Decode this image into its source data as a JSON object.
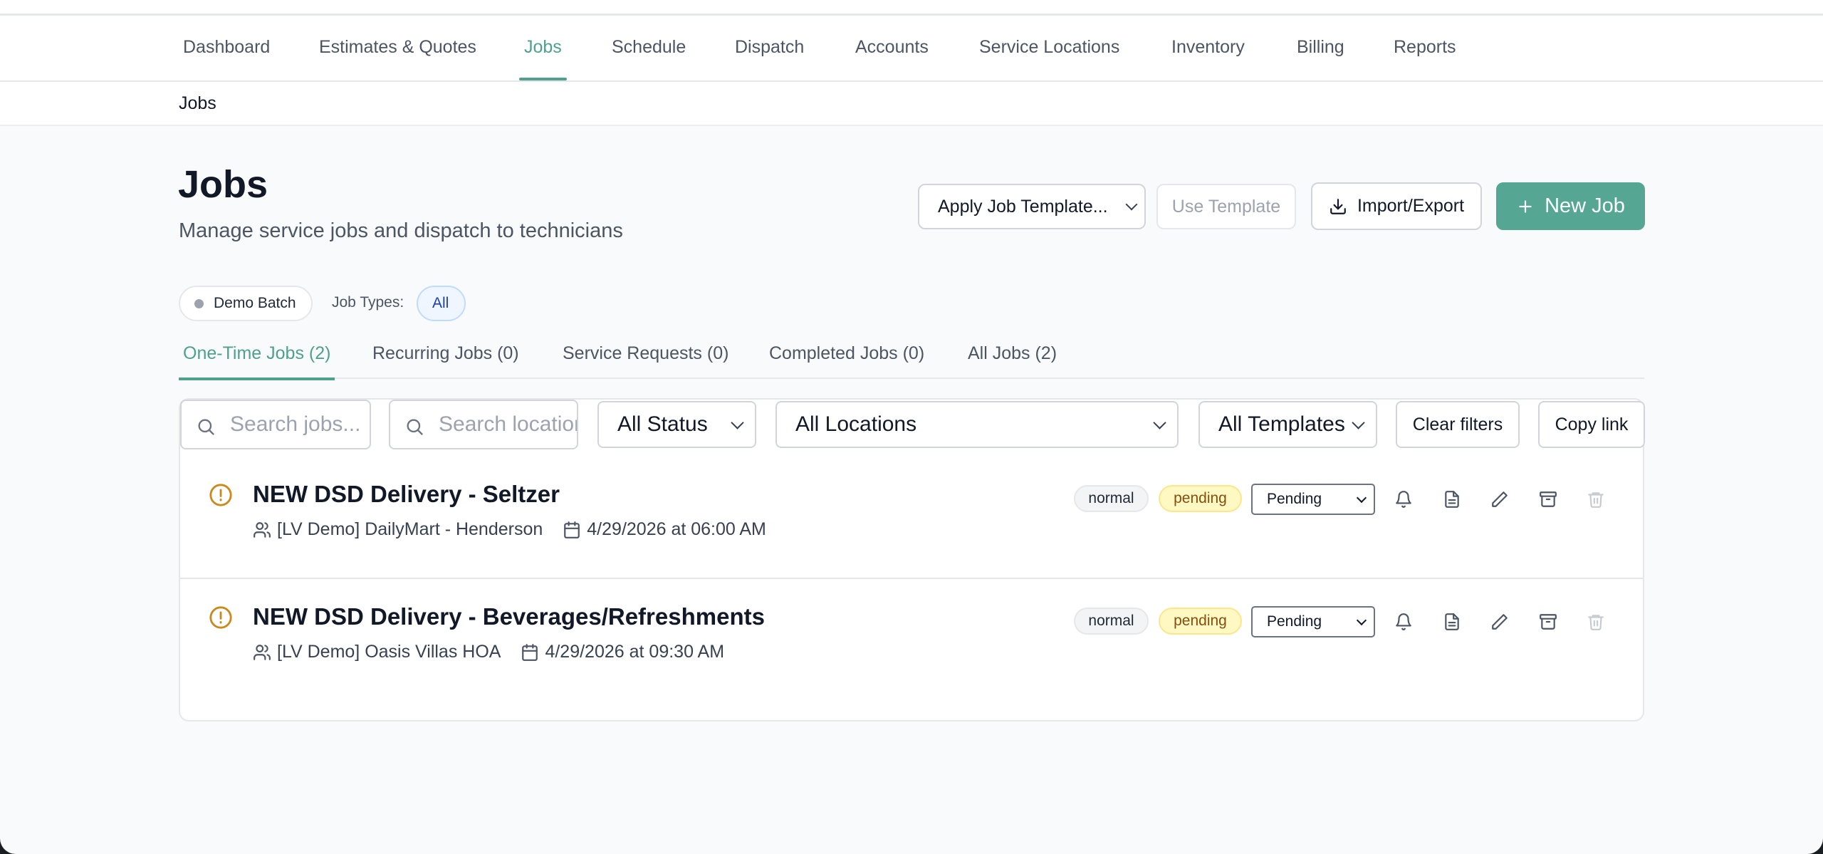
{
  "nav": {
    "items": [
      "Dashboard",
      "Estimates & Quotes",
      "Jobs",
      "Schedule",
      "Dispatch",
      "Accounts",
      "Service Locations",
      "Inventory",
      "Billing",
      "Reports"
    ],
    "active": "Jobs"
  },
  "breadcrumb": "Jobs",
  "page": {
    "title": "Jobs",
    "subtitle": "Manage service jobs and dispatch to technicians"
  },
  "toolbar": {
    "apply_template": "Apply Job Template...",
    "use_template": "Use Template",
    "import_export": "Import/Export",
    "new_job": "New Job"
  },
  "batch": {
    "label": "Demo Batch",
    "job_types_label": "Job Types:",
    "job_types_value": "All"
  },
  "tabs": [
    {
      "label": "One-Time Jobs (2)",
      "active": true
    },
    {
      "label": "Recurring Jobs (0)",
      "active": false
    },
    {
      "label": "Service Requests (0)",
      "active": false
    },
    {
      "label": "Completed Jobs (0)",
      "active": false
    },
    {
      "label": "All Jobs (2)",
      "active": false
    }
  ],
  "filters": {
    "search_jobs_placeholder": "Search jobs...",
    "search_locations_placeholder": "Search locations...",
    "status": "All Status",
    "locations": "All Locations",
    "templates": "All Templates",
    "clear": "Clear filters",
    "copy_link": "Copy link"
  },
  "jobs": [
    {
      "title": "NEW DSD Delivery - Seltzer",
      "account": "[LV Demo] DailyMart - Henderson",
      "datetime": "4/29/2026 at 06:00 AM",
      "priority": "normal",
      "status_badge": "pending",
      "status_select": "Pending"
    },
    {
      "title": "NEW DSD Delivery - Beverages/Refreshments",
      "account": "[LV Demo] Oasis Villas HOA",
      "datetime": "4/29/2026 at 09:30 AM",
      "priority": "normal",
      "status_badge": "pending",
      "status_select": "Pending"
    }
  ],
  "colors": {
    "accent": "#4fa08c",
    "primary_button": "#55a793",
    "warning": "#c98a1b",
    "pending_bg": "#fef9c3"
  },
  "icons": {
    "row_warning": "alert-circle-icon",
    "account": "users-icon",
    "date": "calendar-icon",
    "actions": [
      "bell-icon",
      "document-icon",
      "pencil-icon",
      "archive-icon",
      "trash-icon"
    ]
  }
}
